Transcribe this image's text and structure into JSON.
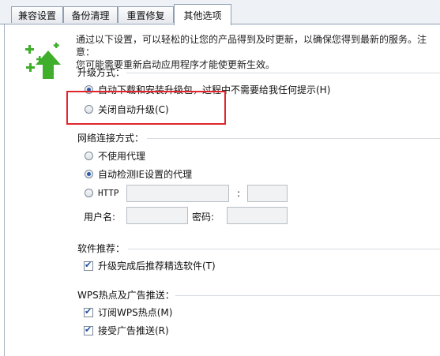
{
  "tabs": [
    "兼容设置",
    "备份清理",
    "重置修复",
    "其他选项"
  ],
  "intro": {
    "line1": "通过以下设置，可以轻松的让您的产品得到及时更新，以确保您得到最新的服务。注意：",
    "line2": "您可能需要重新启动应用程序才能使更新生效。"
  },
  "upgrade": {
    "title": "升级方式：",
    "options": [
      "自动下载和安装升级包，过程中不需要给我任何提示(H)",
      "关闭自动升级(C)"
    ]
  },
  "network": {
    "title": "网络连接方式：",
    "no_proxy": "不使用代理",
    "auto_ie": "自动检测IE设置的代理",
    "http": "HTTP",
    "colon": ":",
    "username": "用户名:",
    "password": "密码:"
  },
  "software": {
    "title": "软件推荐：",
    "recommend": "升级完成后推荐精选软件(T)"
  },
  "wps": {
    "title": "WPS热点及广告推送：",
    "subscribe": "订阅WPS热点(M)",
    "accept_ads": "接受广告推送(R)"
  },
  "colors": {
    "accent": "#2a5aa8",
    "highlight": "#e0252c",
    "icon_green": "#3fae2a"
  }
}
